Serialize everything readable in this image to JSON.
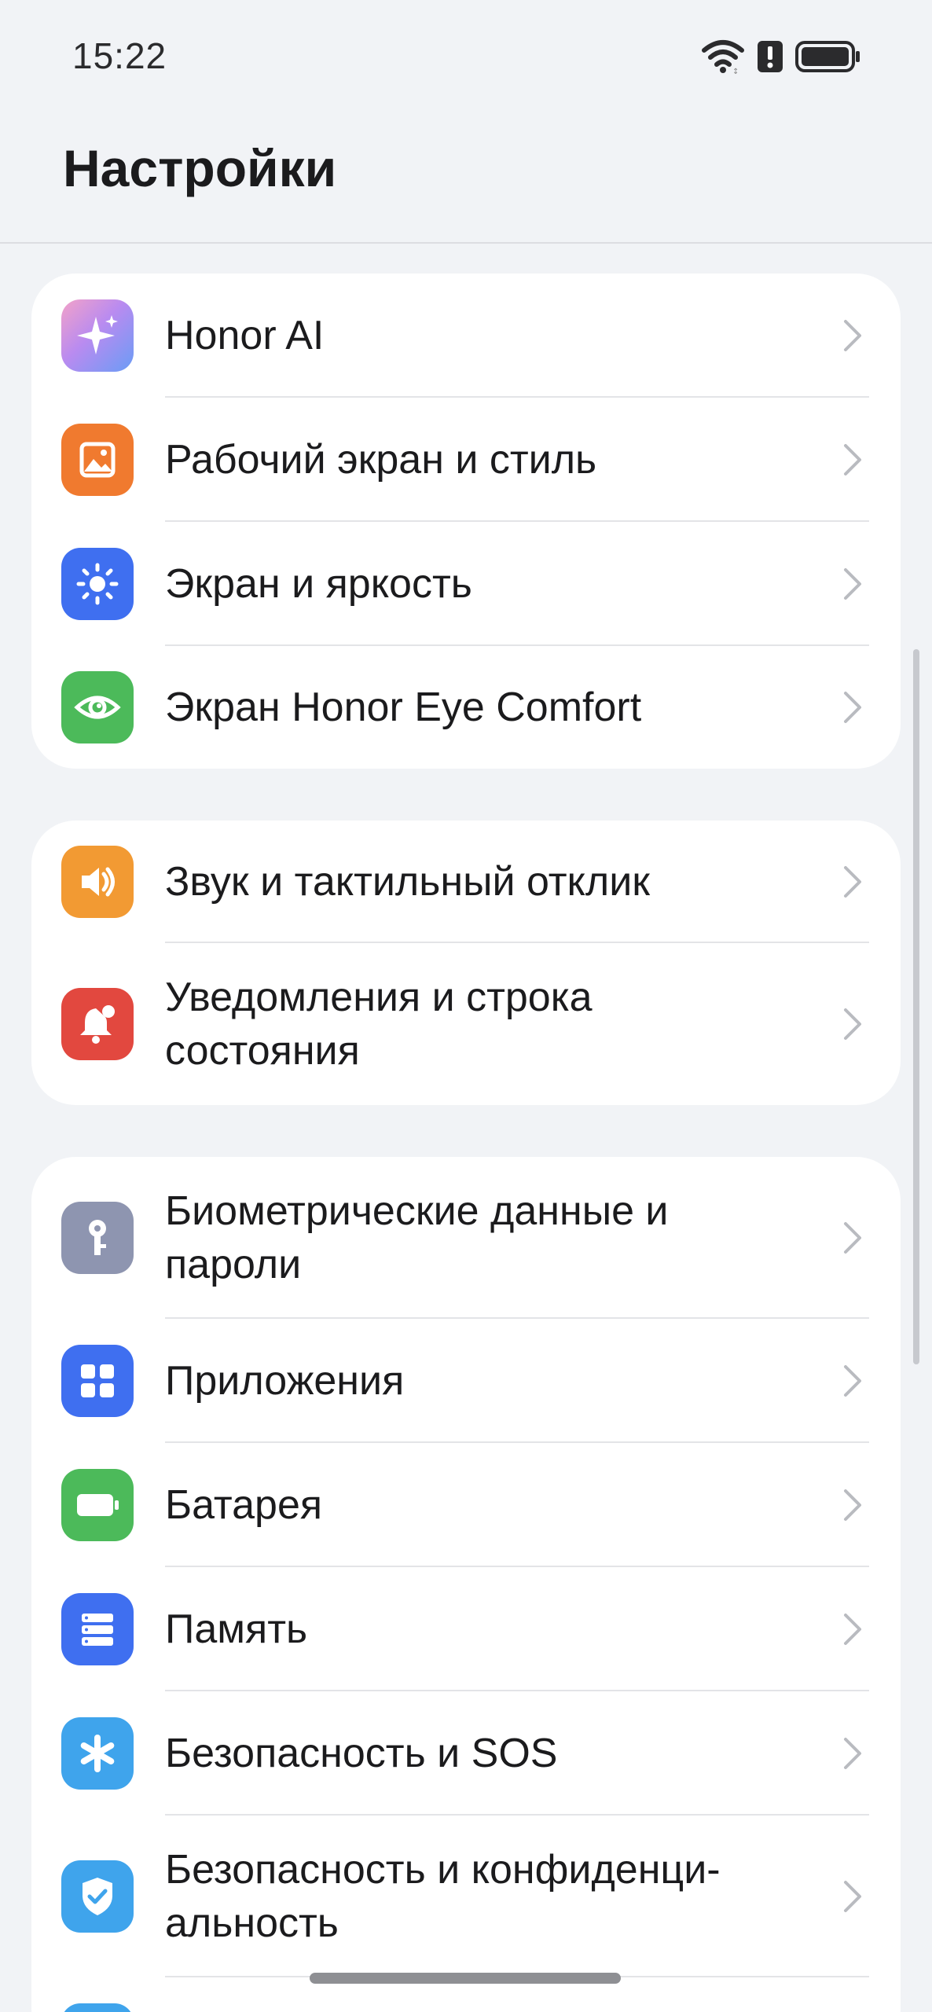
{
  "status_bar": {
    "time": "15:22",
    "icons": [
      "wifi-icon",
      "alert-icon",
      "battery-icon"
    ]
  },
  "header": {
    "title": "Настройки"
  },
  "groups": [
    {
      "items": [
        {
          "label": "Honor AI",
          "icon": "honor-ai-icon",
          "color": "#b98bf0"
        },
        {
          "label": "Рабочий экран и стиль",
          "icon": "picture-icon",
          "color": "#f07a2f"
        },
        {
          "label": "Экран и яркость",
          "icon": "sun-icon",
          "color": "#3f6ff0"
        },
        {
          "label": "Экран Honor Eye Comfort",
          "icon": "eye-icon",
          "color": "#4cba5a"
        }
      ]
    },
    {
      "items": [
        {
          "label": "Звук и тактильный отклик",
          "icon": "speaker-icon",
          "color": "#f29a33"
        },
        {
          "label": "Уведомления и строка\nсостояния",
          "icon": "bell-icon",
          "color": "#e2483f"
        }
      ]
    },
    {
      "items": [
        {
          "label": "Биометрические данные и\nпароли",
          "icon": "key-icon",
          "color": "#8e95b0"
        },
        {
          "label": "Приложения",
          "icon": "apps-grid-icon",
          "color": "#3f6ff0"
        },
        {
          "label": "Батарея",
          "icon": "battery-item-icon",
          "color": "#4cba5a"
        },
        {
          "label": "Память",
          "icon": "storage-icon",
          "color": "#3f6ff0"
        },
        {
          "label": "Безопасность и SOS",
          "icon": "asterisk-icon",
          "color": "#3fa4ec"
        },
        {
          "label": "Безопасность и конфиденци-\nальность",
          "icon": "shield-check-icon",
          "color": "#3fa4ec"
        }
      ]
    }
  ]
}
